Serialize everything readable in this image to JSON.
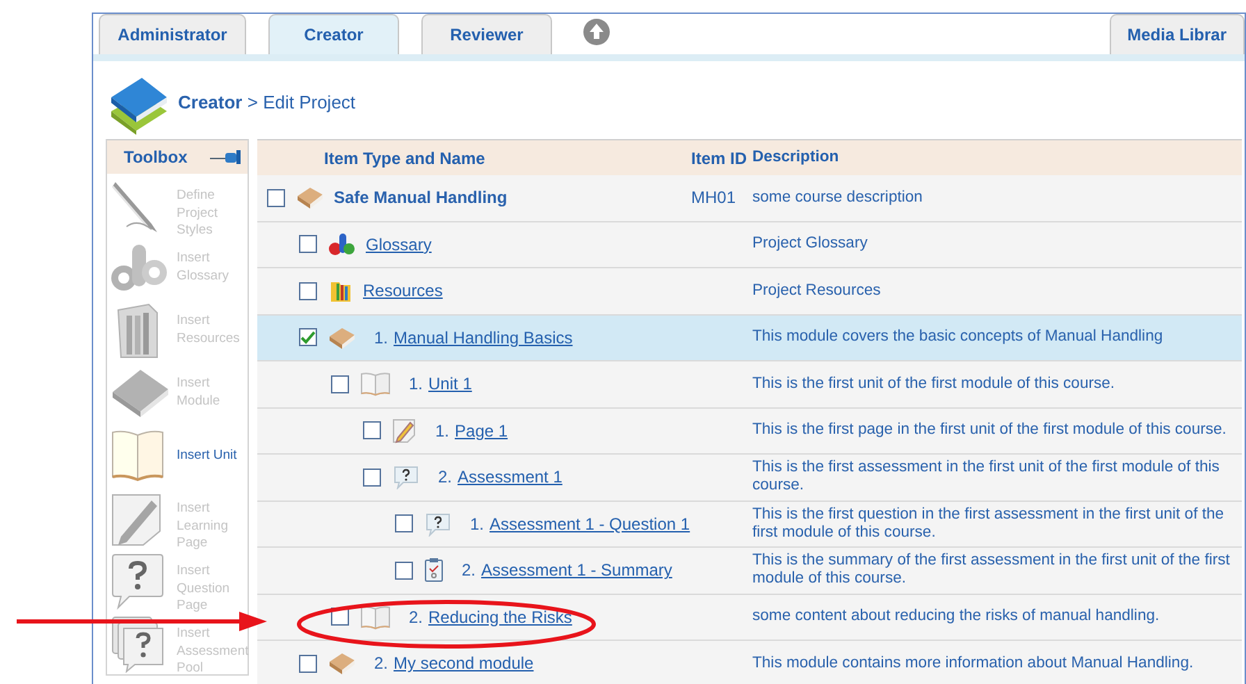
{
  "tabs": [
    {
      "label": "Administrator",
      "selected": false
    },
    {
      "label": "Creator",
      "selected": true
    },
    {
      "label": "Reviewer",
      "selected": false
    }
  ],
  "right_tabs": [
    {
      "label": "Media Librar",
      "selected": false
    }
  ],
  "breadcrumb": {
    "section": "Creator",
    "separator": ">",
    "page": "Edit Project"
  },
  "toolbox": {
    "title": "Toolbox",
    "items": [
      {
        "kind": "styles",
        "label": "Define Project Styles",
        "disabled": true
      },
      {
        "kind": "glossary",
        "label": "Insert Glossary",
        "disabled": true
      },
      {
        "kind": "resources",
        "label": "Insert Resources",
        "disabled": true
      },
      {
        "kind": "module",
        "label": "Insert Module",
        "disabled": true
      },
      {
        "kind": "unit",
        "label": "Insert Unit",
        "disabled": false
      },
      {
        "kind": "page",
        "label": "Insert Learning Page",
        "disabled": true
      },
      {
        "kind": "question",
        "label": "Insert Question Page",
        "disabled": true
      },
      {
        "kind": "pool",
        "label": "Insert Assessment Pool",
        "disabled": true
      }
    ]
  },
  "table": {
    "columns": [
      "Item Type and Name",
      "Item ID",
      "Description"
    ],
    "rows": [
      {
        "kind": "course",
        "name": "Safe Manual Handling",
        "item_id": "MH01",
        "description": "some course description",
        "checked": false,
        "selected": false,
        "children": [
          {
            "kind": "glossary",
            "name": "Glossary",
            "description": "Project Glossary",
            "checked": false,
            "selected": false
          },
          {
            "kind": "resources",
            "name": "Resources",
            "description": "Project Resources",
            "checked": false,
            "selected": false
          },
          {
            "kind": "module",
            "number": "1.",
            "name": "Manual Handling Basics",
            "description": "This module covers the basic concepts of Manual Handling",
            "checked": true,
            "selected": true,
            "children": [
              {
                "kind": "unit",
                "number": "1.",
                "name": "Unit 1",
                "description": "This is the first unit of the first module of this course.",
                "checked": false,
                "selected": false,
                "children": [
                  {
                    "kind": "page",
                    "number": "1.",
                    "name": "Page 1",
                    "description": "This is the first page in the first unit of the first module of this course.",
                    "checked": false,
                    "selected": false
                  },
                  {
                    "kind": "assessment",
                    "number": "2.",
                    "name": "Assessment 1",
                    "description": "This is the first assessment in the first unit of the first module of this course.",
                    "checked": false,
                    "selected": false,
                    "children": [
                      {
                        "kind": "question",
                        "number": "1.",
                        "name": "Assessment 1 - Question 1",
                        "description": "This is the first question in the first assessment in the first unit of the first module of this course.",
                        "checked": false,
                        "selected": false
                      },
                      {
                        "kind": "summary",
                        "number": "2.",
                        "name": "Assessment 1 - Summary",
                        "description": "This is the summary of the first assessment in the first unit of the first module of this course.",
                        "checked": false,
                        "selected": false
                      }
                    ]
                  }
                ]
              },
              {
                "kind": "unit",
                "number": "2.",
                "name": "Reducing the Risks",
                "description": "some content about reducing the risks of manual handling.",
                "checked": false,
                "selected": false
              }
            ]
          },
          {
            "kind": "module",
            "number": "2.",
            "name": "My second module",
            "description": "This module contains more information about Manual Handling.",
            "checked": false,
            "selected": false
          }
        ]
      }
    ]
  }
}
